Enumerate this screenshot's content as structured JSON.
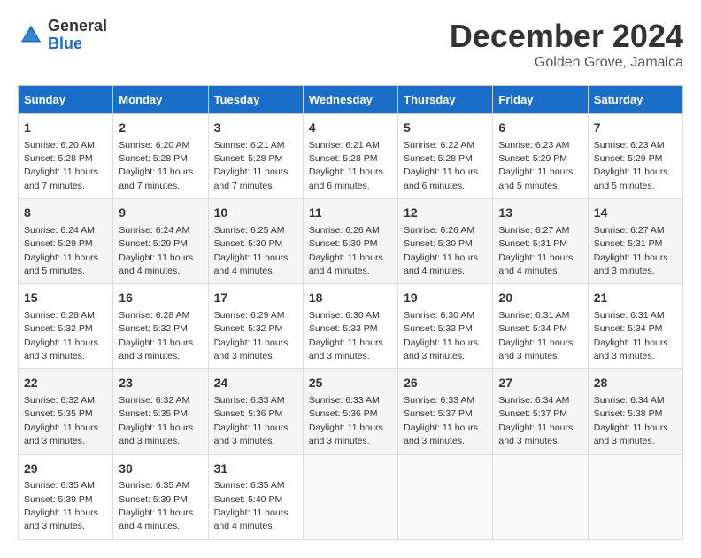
{
  "logo": {
    "general": "General",
    "blue": "Blue"
  },
  "title": {
    "month": "December 2024",
    "location": "Golden Grove, Jamaica"
  },
  "header": {
    "days": [
      "Sunday",
      "Monday",
      "Tuesday",
      "Wednesday",
      "Thursday",
      "Friday",
      "Saturday"
    ]
  },
  "weeks": [
    [
      {
        "day": "1",
        "info": "Sunrise: 6:20 AM\nSunset: 5:28 PM\nDaylight: 11 hours\nand 7 minutes."
      },
      {
        "day": "2",
        "info": "Sunrise: 6:20 AM\nSunset: 5:28 PM\nDaylight: 11 hours\nand 7 minutes."
      },
      {
        "day": "3",
        "info": "Sunrise: 6:21 AM\nSunset: 5:28 PM\nDaylight: 11 hours\nand 7 minutes."
      },
      {
        "day": "4",
        "info": "Sunrise: 6:21 AM\nSunset: 5:28 PM\nDaylight: 11 hours\nand 6 minutes."
      },
      {
        "day": "5",
        "info": "Sunrise: 6:22 AM\nSunset: 5:28 PM\nDaylight: 11 hours\nand 6 minutes."
      },
      {
        "day": "6",
        "info": "Sunrise: 6:23 AM\nSunset: 5:29 PM\nDaylight: 11 hours\nand 5 minutes."
      },
      {
        "day": "7",
        "info": "Sunrise: 6:23 AM\nSunset: 5:29 PM\nDaylight: 11 hours\nand 5 minutes."
      }
    ],
    [
      {
        "day": "8",
        "info": "Sunrise: 6:24 AM\nSunset: 5:29 PM\nDaylight: 11 hours\nand 5 minutes."
      },
      {
        "day": "9",
        "info": "Sunrise: 6:24 AM\nSunset: 5:29 PM\nDaylight: 11 hours\nand 4 minutes."
      },
      {
        "day": "10",
        "info": "Sunrise: 6:25 AM\nSunset: 5:30 PM\nDaylight: 11 hours\nand 4 minutes."
      },
      {
        "day": "11",
        "info": "Sunrise: 6:26 AM\nSunset: 5:30 PM\nDaylight: 11 hours\nand 4 minutes."
      },
      {
        "day": "12",
        "info": "Sunrise: 6:26 AM\nSunset: 5:30 PM\nDaylight: 11 hours\nand 4 minutes."
      },
      {
        "day": "13",
        "info": "Sunrise: 6:27 AM\nSunset: 5:31 PM\nDaylight: 11 hours\nand 4 minutes."
      },
      {
        "day": "14",
        "info": "Sunrise: 6:27 AM\nSunset: 5:31 PM\nDaylight: 11 hours\nand 3 minutes."
      }
    ],
    [
      {
        "day": "15",
        "info": "Sunrise: 6:28 AM\nSunset: 5:32 PM\nDaylight: 11 hours\nand 3 minutes."
      },
      {
        "day": "16",
        "info": "Sunrise: 6:28 AM\nSunset: 5:32 PM\nDaylight: 11 hours\nand 3 minutes."
      },
      {
        "day": "17",
        "info": "Sunrise: 6:29 AM\nSunset: 5:32 PM\nDaylight: 11 hours\nand 3 minutes."
      },
      {
        "day": "18",
        "info": "Sunrise: 6:30 AM\nSunset: 5:33 PM\nDaylight: 11 hours\nand 3 minutes."
      },
      {
        "day": "19",
        "info": "Sunrise: 6:30 AM\nSunset: 5:33 PM\nDaylight: 11 hours\nand 3 minutes."
      },
      {
        "day": "20",
        "info": "Sunrise: 6:31 AM\nSunset: 5:34 PM\nDaylight: 11 hours\nand 3 minutes."
      },
      {
        "day": "21",
        "info": "Sunrise: 6:31 AM\nSunset: 5:34 PM\nDaylight: 11 hours\nand 3 minutes."
      }
    ],
    [
      {
        "day": "22",
        "info": "Sunrise: 6:32 AM\nSunset: 5:35 PM\nDaylight: 11 hours\nand 3 minutes."
      },
      {
        "day": "23",
        "info": "Sunrise: 6:32 AM\nSunset: 5:35 PM\nDaylight: 11 hours\nand 3 minutes."
      },
      {
        "day": "24",
        "info": "Sunrise: 6:33 AM\nSunset: 5:36 PM\nDaylight: 11 hours\nand 3 minutes."
      },
      {
        "day": "25",
        "info": "Sunrise: 6:33 AM\nSunset: 5:36 PM\nDaylight: 11 hours\nand 3 minutes."
      },
      {
        "day": "26",
        "info": "Sunrise: 6:33 AM\nSunset: 5:37 PM\nDaylight: 11 hours\nand 3 minutes."
      },
      {
        "day": "27",
        "info": "Sunrise: 6:34 AM\nSunset: 5:37 PM\nDaylight: 11 hours\nand 3 minutes."
      },
      {
        "day": "28",
        "info": "Sunrise: 6:34 AM\nSunset: 5:38 PM\nDaylight: 11 hours\nand 3 minutes."
      }
    ],
    [
      {
        "day": "29",
        "info": "Sunrise: 6:35 AM\nSunset: 5:39 PM\nDaylight: 11 hours\nand 3 minutes."
      },
      {
        "day": "30",
        "info": "Sunrise: 6:35 AM\nSunset: 5:39 PM\nDaylight: 11 hours\nand 4 minutes."
      },
      {
        "day": "31",
        "info": "Sunrise: 6:35 AM\nSunset: 5:40 PM\nDaylight: 11 hours\nand 4 minutes."
      },
      null,
      null,
      null,
      null
    ]
  ]
}
